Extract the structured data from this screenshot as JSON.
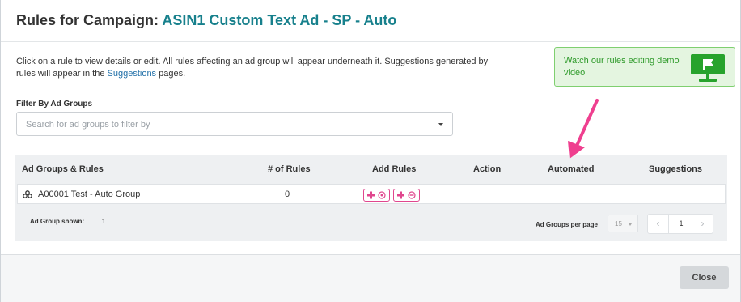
{
  "header": {
    "title_prefix": "Rules for Campaign:",
    "campaign_name": "ASIN1 Custom Text Ad - SP - Auto"
  },
  "intro": {
    "text_before_link": "Click on a rule to view details or edit. All rules affecting an ad group will appear underneath it. Suggestions generated by rules will appear in the ",
    "link_text": "Suggestions",
    "text_after_link": " pages."
  },
  "demo": {
    "text": "Watch our rules editing demo video",
    "icon": "monitor-flag-icon",
    "color": "#2e9a2a"
  },
  "filter": {
    "label": "Filter By Ad Groups",
    "placeholder": "Search for ad groups to filter by"
  },
  "table": {
    "columns": [
      "Ad Groups & Rules",
      "# of Rules",
      "Add Rules",
      "Action",
      "Automated",
      "Suggestions"
    ],
    "rows": [
      {
        "icon": "ad-group-icon",
        "name": "A00001 Test - Auto Group",
        "num_rules": "0",
        "add_rule_icons": [
          "add-rule-icon",
          "add-negative-rule-icon"
        ]
      }
    ]
  },
  "footer_grid": {
    "shown_label": "Ad Group shown:",
    "shown_value": "1",
    "per_page_label": "Ad Groups per page",
    "per_page_value": "15",
    "current_page": "1",
    "prev_icon": "chevron-left-icon",
    "next_icon": "chevron-right-icon"
  },
  "footer": {
    "close_label": "Close"
  },
  "colors": {
    "accent_teal": "#17808c",
    "link_blue": "#1f6fa8",
    "annotation_pink": "#ef3f8f",
    "add_button_border": "#e0468e"
  }
}
